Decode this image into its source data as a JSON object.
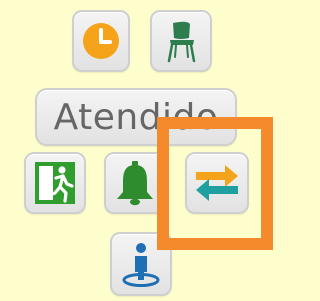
{
  "toolbar": {
    "status_label": "Atendido",
    "buttons": [
      {
        "id": "clock",
        "icon": "clock-icon"
      },
      {
        "id": "chair",
        "icon": "chair-icon"
      },
      {
        "id": "exit",
        "icon": "emergency-exit-icon"
      },
      {
        "id": "bell",
        "icon": "bell-icon"
      },
      {
        "id": "transfer",
        "icon": "transfer-arrows-icon"
      },
      {
        "id": "info",
        "icon": "person-location-icon"
      }
    ]
  },
  "highlight": {
    "target": "transfer-button",
    "color": "#f58a2c"
  },
  "colors": {
    "background": "#fefecc",
    "clock_orange": "#f5a31a",
    "chair_green": "#2e7d4f",
    "exit_green": "#2f9e2f",
    "bell_green": "#2e8b2e",
    "arrow_orange": "#f5a31a",
    "arrow_teal": "#1fa0a0",
    "info_blue": "#1f6fb5"
  }
}
